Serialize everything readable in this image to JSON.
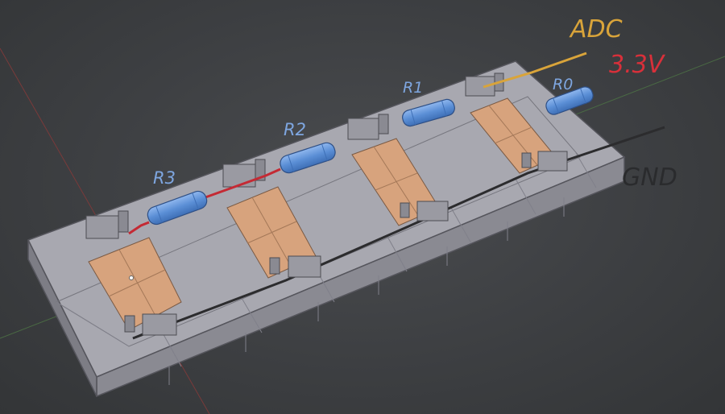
{
  "labels": {
    "adc": "ADC",
    "v33": "3.3V",
    "gnd": "GND",
    "r0": "R0",
    "r1": "R1",
    "r2": "R2",
    "r3": "R3"
  },
  "colors": {
    "adc": "#d9a43a",
    "v33": "#d8303a",
    "gnd": "#2a2b2d",
    "resistor_label": "#7ea6e0",
    "resistor_body": "#5b8fd6",
    "base_top": "#a6a6ae",
    "base_side": "#8b8b93",
    "pad": "#d7a37d",
    "wire_red": "#c42a34",
    "wire_gnd": "#2c2c2e"
  }
}
